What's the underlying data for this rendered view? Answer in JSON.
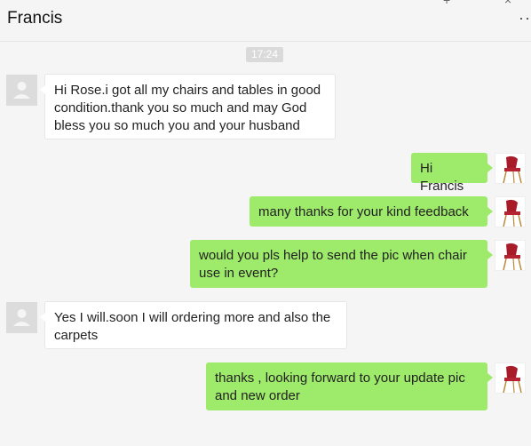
{
  "header": {
    "title": "Francis"
  },
  "time": "17:24",
  "messages": [
    {
      "from": "contact",
      "text": "Hi Rose.i got all my chairs and tables in good condition.thank you so much and may God bless you so much you and your husband"
    },
    {
      "from": "me",
      "text": "Hi Francis"
    },
    {
      "from": "me",
      "text": "many thanks for your kind feedback"
    },
    {
      "from": "me",
      "text": "would you pls help to send the pic when chair use in event?"
    },
    {
      "from": "contact",
      "text": "Yes I will.soon I will ordering more and also the carpets"
    },
    {
      "from": "me",
      "text": "thanks , looking forward to your update pic and new order"
    }
  ],
  "icons": {
    "contact_avatar": "person-silhouette-icon",
    "my_avatar": "red-chair-icon",
    "more": "more-dots-icon"
  },
  "colors": {
    "outgoing_bubble": "#9eea6a",
    "incoming_bubble": "#ffffff"
  }
}
